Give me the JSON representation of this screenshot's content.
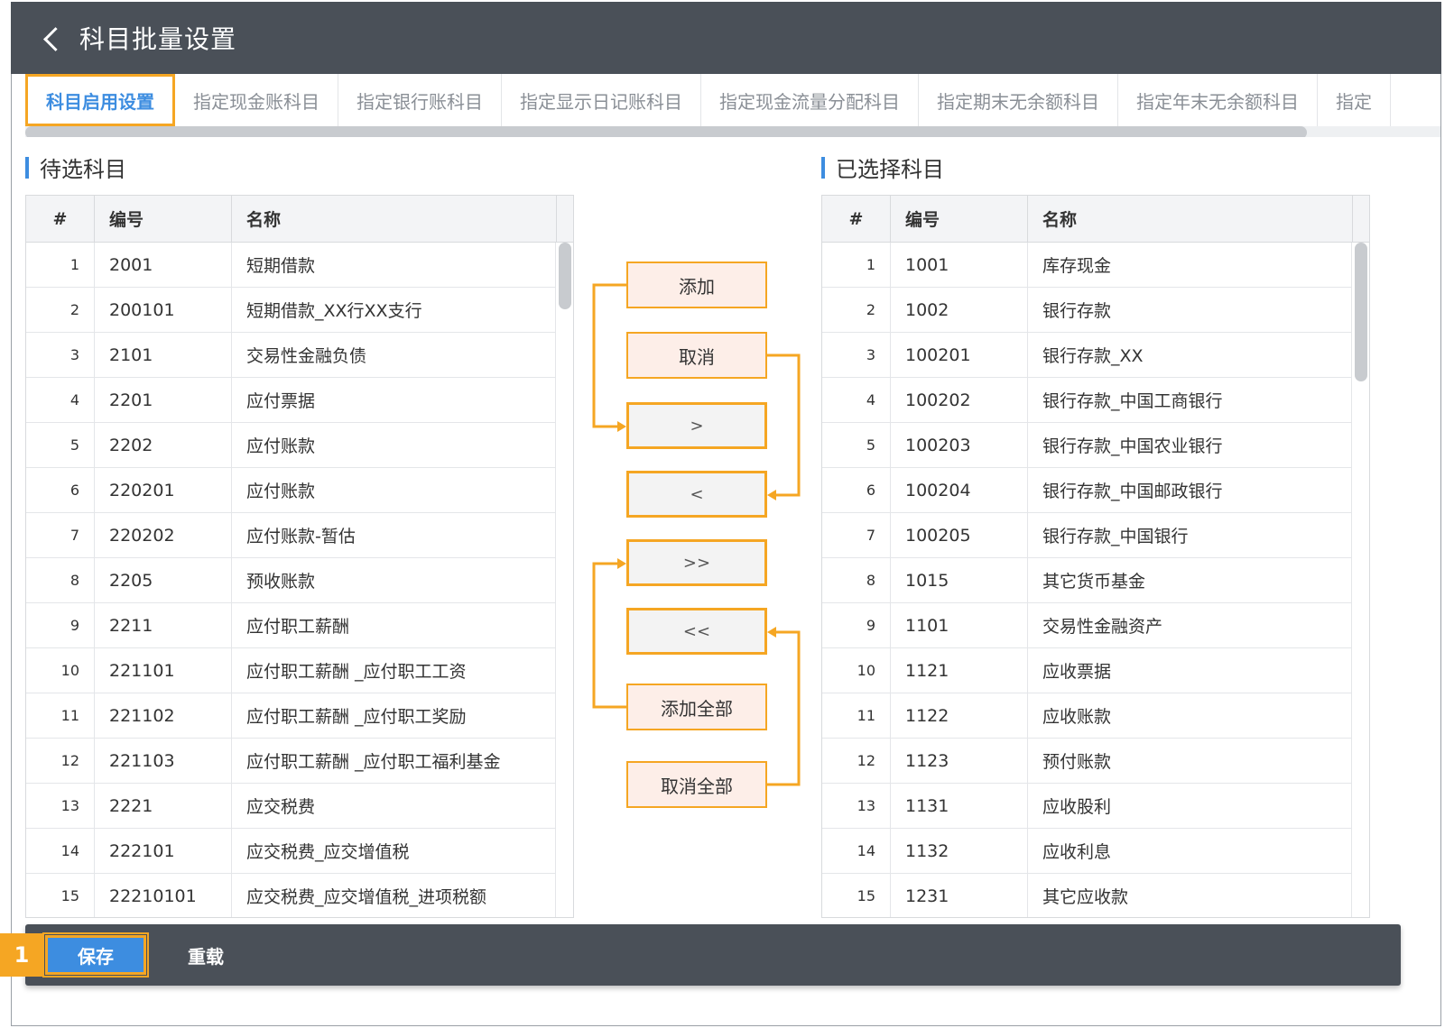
{
  "header": {
    "title": "科目批量设置"
  },
  "tabs": [
    {
      "label": "科目启用设置",
      "active": true
    },
    {
      "label": "指定现金账科目"
    },
    {
      "label": "指定银行账科目"
    },
    {
      "label": "指定显示日记账科目"
    },
    {
      "label": "指定现金流量分配科目"
    },
    {
      "label": "指定期末无余额科目"
    },
    {
      "label": "指定年末无余额科目"
    },
    {
      "label": "指定"
    }
  ],
  "left": {
    "title": "待选科目",
    "headers": [
      "#",
      "编号",
      "名称"
    ],
    "rows": [
      [
        "1",
        "2001",
        "短期借款"
      ],
      [
        "2",
        "200101",
        "短期借款_XX行XX支行"
      ],
      [
        "3",
        "2101",
        "交易性金融负债"
      ],
      [
        "4",
        "2201",
        "应付票据"
      ],
      [
        "5",
        "2202",
        "应付账款"
      ],
      [
        "6",
        "220201",
        "应付账款"
      ],
      [
        "7",
        "220202",
        "应付账款-暂估"
      ],
      [
        "8",
        "2205",
        "预收账款"
      ],
      [
        "9",
        "2211",
        "应付职工薪酬"
      ],
      [
        "10",
        "221101",
        "应付职工薪酬 _应付职工工资"
      ],
      [
        "11",
        "221102",
        "应付职工薪酬 _应付职工奖励"
      ],
      [
        "12",
        "221103",
        "应付职工薪酬 _应付职工福利基金"
      ],
      [
        "13",
        "2221",
        "应交税费"
      ],
      [
        "14",
        "222101",
        "应交税费_应交增值税"
      ],
      [
        "15",
        "22210101",
        "应交税费_应交增值税_进项税额"
      ]
    ]
  },
  "right": {
    "title": "已选择科目",
    "headers": [
      "#",
      "编号",
      "名称"
    ],
    "rows": [
      [
        "1",
        "1001",
        "库存现金"
      ],
      [
        "2",
        "1002",
        "银行存款"
      ],
      [
        "3",
        "100201",
        "银行存款_XX"
      ],
      [
        "4",
        "100202",
        "银行存款_中国工商银行"
      ],
      [
        "5",
        "100203",
        "银行存款_中国农业银行"
      ],
      [
        "6",
        "100204",
        "银行存款_中国邮政银行"
      ],
      [
        "7",
        "100205",
        "银行存款_中国银行"
      ],
      [
        "8",
        "1015",
        "其它货币基金"
      ],
      [
        "9",
        "1101",
        "交易性金融资产"
      ],
      [
        "10",
        "1121",
        "应收票据"
      ],
      [
        "11",
        "1122",
        "应收账款"
      ],
      [
        "12",
        "1123",
        "预付账款"
      ],
      [
        "13",
        "1131",
        "应收股利"
      ],
      [
        "14",
        "1132",
        "应收利息"
      ],
      [
        "15",
        "1231",
        "其它应收款"
      ]
    ]
  },
  "middle": {
    "add": "添加",
    "cancel": "取消",
    "move_right": ">",
    "move_left": "<",
    "move_all_right": ">>",
    "move_all_left": "<<",
    "add_all": "添加全部",
    "cancel_all": "取消全部"
  },
  "footer": {
    "save": "保存",
    "reload": "重载",
    "step": "1"
  },
  "colors": {
    "header_bg": "#4a5058",
    "accent": "#3d8de0",
    "highlight": "#f5a623"
  }
}
